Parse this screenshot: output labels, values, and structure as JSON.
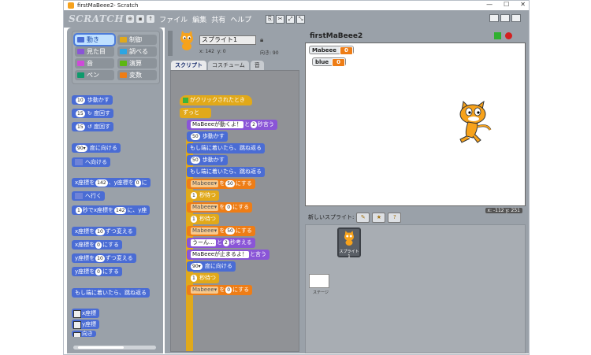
{
  "window": {
    "title": "firstMaBeee2- Scratch"
  },
  "menu": {
    "logo": "SCRATCH",
    "items": [
      "ファイル",
      "編集",
      "共有",
      "ヘルプ"
    ]
  },
  "categories": [
    {
      "label": "動き",
      "color": "#4a6cd4",
      "selected": true
    },
    {
      "label": "制御",
      "color": "#e1a91a"
    },
    {
      "label": "見た目",
      "color": "#8a55d7"
    },
    {
      "label": "調べる",
      "color": "#2ca5e2"
    },
    {
      "label": "音",
      "color": "#cf4ad9"
    },
    {
      "label": "演算",
      "color": "#5cb712"
    },
    {
      "label": "ペン",
      "color": "#0e9a6c"
    },
    {
      "label": "変数",
      "color": "#ee7d16"
    }
  ],
  "palette": {
    "move": {
      "n": "10",
      "t": "歩動かす"
    },
    "turn_cw": {
      "n": "15",
      "t": "度回す"
    },
    "turn_ccw": {
      "n": "15",
      "t": "度回す"
    },
    "point_dir": {
      "n": "90▾",
      "t": "度に向ける"
    },
    "point_to": "へ向ける",
    "goto_xy": {
      "a": "x座標を",
      "x": "142",
      "b": "、y座標を",
      "y": "0",
      "c": "に"
    },
    "goto": "へ行く",
    "glide": {
      "n": "1",
      "a": "秒でx座標を",
      "x": "142",
      "b": "に、y座"
    },
    "change_x": {
      "a": "x座標を",
      "n": "10",
      "b": "ずつ変える"
    },
    "set_x": {
      "a": "x座標を",
      "n": "0",
      "b": "にする"
    },
    "change_y": {
      "a": "y座標を",
      "n": "10",
      "b": "ずつ変える"
    },
    "set_y": {
      "a": "y座標を",
      "n": "0",
      "b": "にする"
    },
    "bounce": "もし端に着いたら、跳ね返る",
    "rep_x": "x座標",
    "rep_y": "y座標",
    "rep_dir": "向き"
  },
  "sprite": {
    "name": "スプライト1",
    "x": "x: 142",
    "y": "y: 0",
    "direction": "向き: 90"
  },
  "tabs": [
    "スクリプト",
    "コスチューム",
    "音"
  ],
  "script": {
    "hat": "がクリックされたとき",
    "forever": "ずっと",
    "b1": {
      "a": "MaBeeeが動くよ！",
      "b": "と",
      "n": "2",
      "c": "秒言う"
    },
    "b2": {
      "n": "50",
      "t": "歩動かす"
    },
    "b3": "もし端に着いたら、跳ね返る",
    "b4": {
      "n": "50",
      "t": "歩動かす"
    },
    "b5": "もし端に着いたら、跳ね返る",
    "b6": {
      "v": "Mabeee▾",
      "a": "を",
      "n": "50",
      "b": "にする"
    },
    "b7": {
      "n": "1",
      "t": "秒待つ"
    },
    "b8": {
      "v": "Mabeee▾",
      "a": "を",
      "n": "0",
      "b": "にする"
    },
    "b9": {
      "n": "1",
      "t": "秒待つ"
    },
    "b10": {
      "v": "Mabeee▾",
      "a": "を",
      "n": "50",
      "b": "にする"
    },
    "b11": {
      "a": "うーん…",
      "b": "と",
      "n": "2",
      "c": "秒考える"
    },
    "b12": {
      "a": "MaBeeeが止まるよ！",
      "b": "と言う"
    },
    "b13": {
      "n": "90▾",
      "t": "度に向ける"
    },
    "b14": {
      "n": "1",
      "t": "秒待つ"
    },
    "b15": {
      "v": "Mabeee▾",
      "a": "を",
      "n": "0",
      "b": "にする"
    }
  },
  "stage": {
    "title": "firstMaBeee2",
    "monitors": [
      {
        "label": "Mabeee",
        "value": "0"
      },
      {
        "label": "blue",
        "value": "0"
      }
    ],
    "mouse": "x: -112  y: 251"
  },
  "newsprite": {
    "label": "新しいスプライト:"
  },
  "sprites": [
    {
      "name": "スプライト1"
    }
  ],
  "stage_thumb": {
    "label": "ステージ"
  }
}
